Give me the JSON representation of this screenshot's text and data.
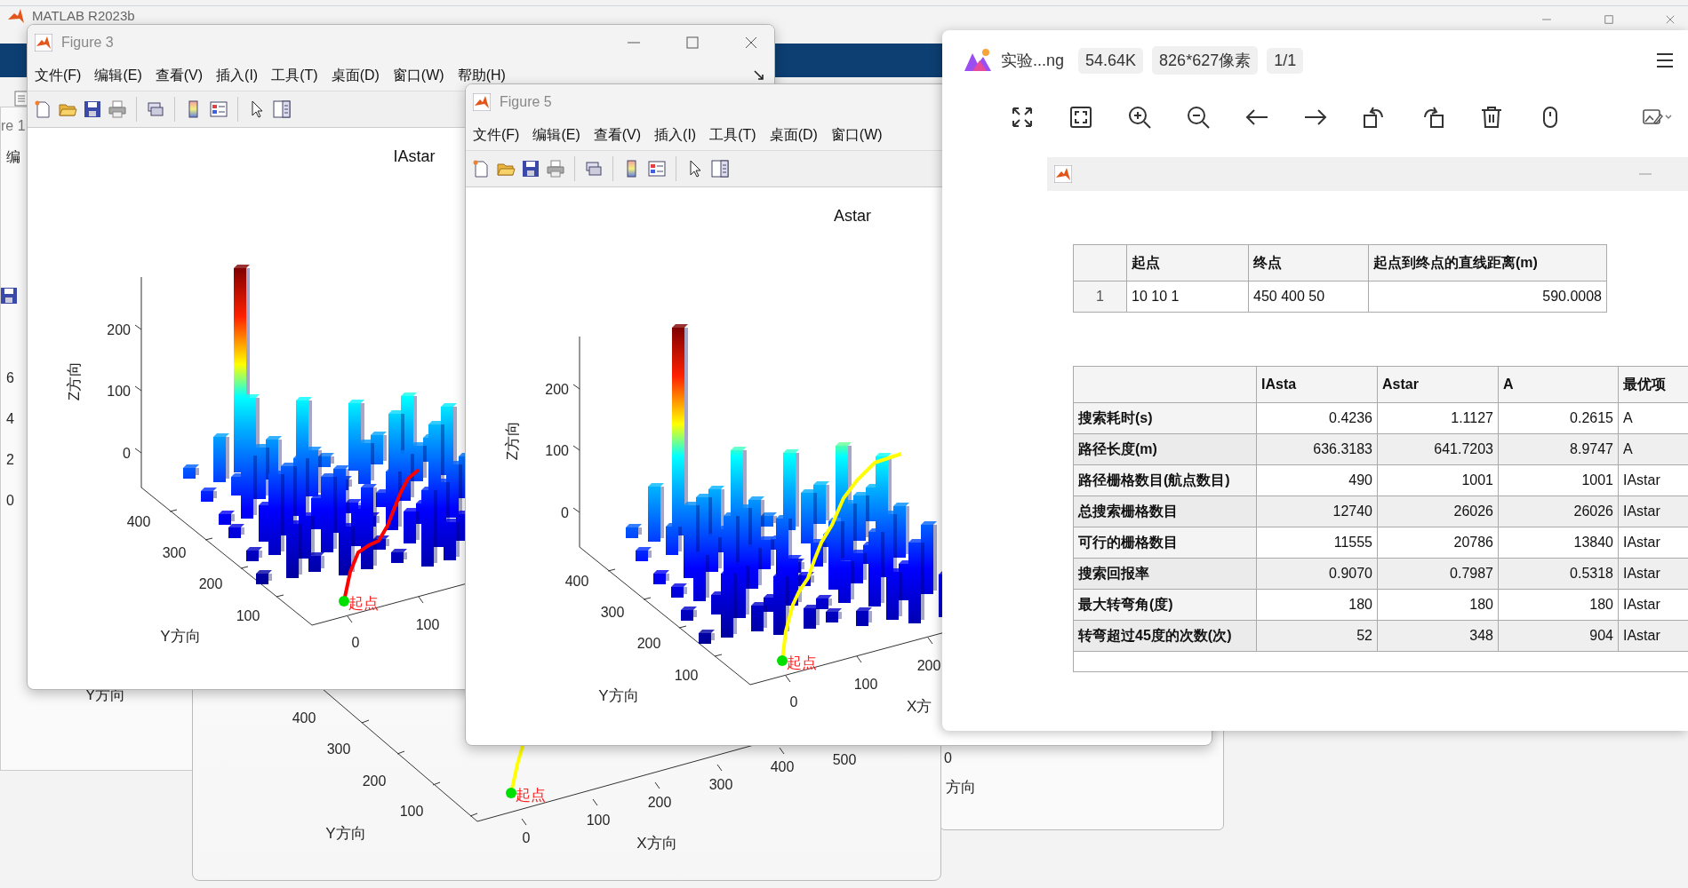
{
  "desktop": {
    "app_title": "MATLAB R2023b"
  },
  "left_figure": {
    "title": "re 1",
    "menu_item": "编",
    "z_ticks": [
      "6",
      "4",
      "2",
      "0"
    ],
    "y_label": "Y方向"
  },
  "figures": [
    {
      "title": "Figure 3",
      "menus": [
        "文件(F)",
        "编辑(E)",
        "查看(V)",
        "插入(I)",
        "工具(T)",
        "桌面(D)",
        "窗口(W)",
        "帮助(H)"
      ],
      "plot": {
        "title": "IAstar",
        "z_label": "Z方向",
        "z_ticks": [
          "200",
          "100",
          "0"
        ],
        "y_label": "Y方向",
        "y_ticks": [
          "400",
          "300",
          "200",
          "100"
        ],
        "x_ticks": [
          "0",
          "100"
        ],
        "start_label": "起点",
        "path": {
          "color": "#ff0000"
        }
      }
    },
    {
      "title": "Figure 5",
      "menus": [
        "文件(F)",
        "编辑(E)",
        "查看(V)",
        "插入(I)",
        "工具(T)",
        "桌面(D)",
        "窗口(W)"
      ],
      "plot": {
        "title": "Astar",
        "z_label": "Z方向",
        "z_ticks": [
          "200",
          "100",
          "0"
        ],
        "y_label": "Y方向",
        "y_ticks": [
          "400",
          "300",
          "200",
          "100"
        ],
        "x_ticks": [
          "0",
          "100",
          "200"
        ],
        "x_label": "X方",
        "start_label": "起点",
        "path": {
          "color": "#ffff00"
        }
      }
    }
  ],
  "bottom_figure": {
    "y_ticks": [
      "400",
      "300",
      "200",
      "100"
    ],
    "y_label": "Y方向",
    "x_ticks": [
      "0",
      "100",
      "200",
      "300",
      "400",
      "500"
    ],
    "x_label": "X方向",
    "start_label": "起点",
    "path": {
      "color": "#ffff00"
    }
  },
  "right_figure": {
    "x_tick": "0",
    "x_label": "方向"
  },
  "viewer": {
    "file_name": "实验...ng",
    "chips": [
      "54.64K",
      "826*627像素",
      "1/1"
    ],
    "table1": {
      "columns": [
        "起点",
        "终点",
        "起点到终点的直线距离(m)"
      ],
      "rows": [
        {
          "label": "1",
          "cells": [
            "10 10 1",
            "450 400 50",
            "590.0008"
          ]
        }
      ]
    },
    "table2": {
      "columns": [
        "IAsta",
        "Astar",
        "A",
        "最优项"
      ],
      "rows": [
        {
          "label": "搜索耗时(s)",
          "cells": [
            "0.4236",
            "1.1127",
            "0.2615",
            "A"
          ]
        },
        {
          "label": "路径长度(m)",
          "cells": [
            "636.3183",
            "641.7203",
            "8.9747",
            "A"
          ]
        },
        {
          "label": "路径栅格数目(航点数目)",
          "cells": [
            "490",
            "1001",
            "1001",
            "IAstar"
          ]
        },
        {
          "label": "总搜索栅格数目",
          "cells": [
            "12740",
            "26026",
            "26026",
            "IAstar"
          ]
        },
        {
          "label": "可行的栅格数目",
          "cells": [
            "11555",
            "20786",
            "13840",
            "IAstar"
          ]
        },
        {
          "label": "搜索回报率",
          "cells": [
            "0.9070",
            "0.7987",
            "0.5318",
            "IAstar"
          ]
        },
        {
          "label": "最大转弯角(度)",
          "cells": [
            "180",
            "180",
            "180",
            "IAstar"
          ]
        },
        {
          "label": "转弯超过45度的次数(次)",
          "cells": [
            "52",
            "348",
            "904",
            "IAstar"
          ]
        }
      ]
    }
  }
}
